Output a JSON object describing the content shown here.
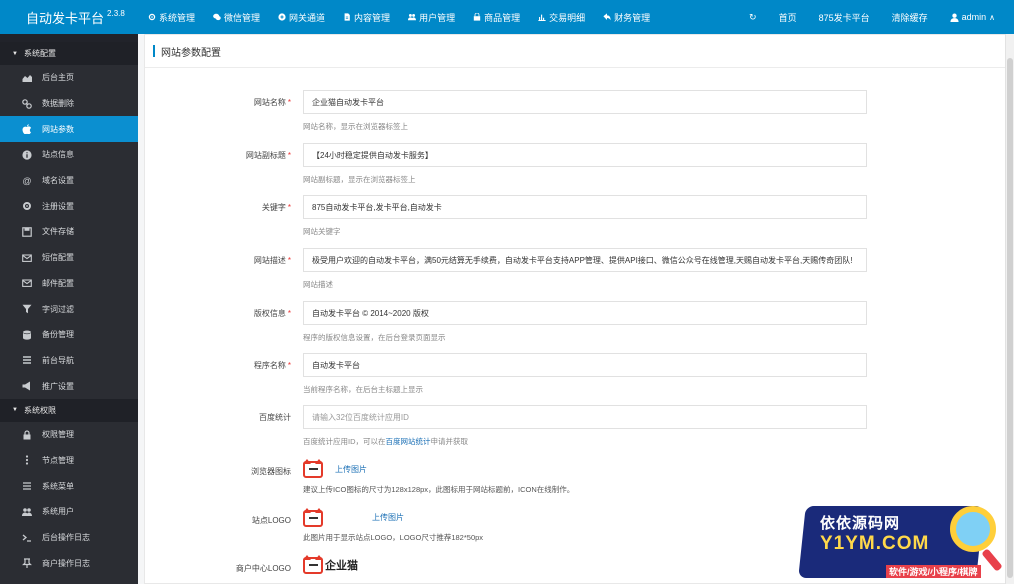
{
  "app": {
    "title": "自动发卡平台",
    "version": "2.3.8"
  },
  "topnav": [
    {
      "label": "系统管理",
      "icon": "gear-icon"
    },
    {
      "label": "微信管理",
      "icon": "wechat-icon"
    },
    {
      "label": "网关通道",
      "icon": "gateway-icon"
    },
    {
      "label": "内容管理",
      "icon": "document-icon"
    },
    {
      "label": "用户管理",
      "icon": "users-icon"
    },
    {
      "label": "商品管理",
      "icon": "shop-icon"
    },
    {
      "label": "交易明细",
      "icon": "chart-icon"
    },
    {
      "label": "财务管理",
      "icon": "finance-icon"
    }
  ],
  "topright": {
    "refresh_icon": "refresh-icon",
    "home": "首页",
    "site": "875发卡平台",
    "clear_cache": "清除缓存",
    "user": "admin"
  },
  "sidebar": {
    "groups": [
      {
        "title": "系统配置",
        "items": [
          {
            "label": "后台主页",
            "icon": "area-chart-icon"
          },
          {
            "label": "数据删除",
            "icon": "link-icon"
          },
          {
            "label": "网站参数",
            "icon": "apple-icon",
            "active": true
          },
          {
            "label": "站点信息",
            "icon": "info-icon"
          },
          {
            "label": "域名设置",
            "icon": "at-icon"
          },
          {
            "label": "注册设置",
            "icon": "cog-icon"
          },
          {
            "label": "文件存储",
            "icon": "save-icon"
          },
          {
            "label": "短信配置",
            "icon": "envelope-icon"
          },
          {
            "label": "邮件配置",
            "icon": "mail-icon"
          },
          {
            "label": "字词过滤",
            "icon": "filter-icon"
          },
          {
            "label": "备份管理",
            "icon": "database-icon"
          },
          {
            "label": "前台导航",
            "icon": "menu-icon"
          },
          {
            "label": "推广设置",
            "icon": "bullhorn-icon"
          }
        ]
      },
      {
        "title": "系统权限",
        "items": [
          {
            "label": "权限管理",
            "icon": "lock-icon"
          },
          {
            "label": "节点管理",
            "icon": "vertical-dots-icon"
          },
          {
            "label": "系统菜单",
            "icon": "list-icon"
          },
          {
            "label": "系统用户",
            "icon": "users-icon"
          },
          {
            "label": "后台操作日志",
            "icon": "terminal-icon"
          },
          {
            "label": "商户操作日志",
            "icon": "pin-icon"
          }
        ]
      }
    ]
  },
  "panel": {
    "title": "网站参数配置"
  },
  "form": {
    "site_name": {
      "label": "网站名称",
      "value": "企业猫自动发卡平台",
      "hint": "网站名称，显示在浏览器标签上"
    },
    "subtitle": {
      "label": "网站副标题",
      "value": "【24小时稳定提供自动发卡服务】",
      "hint": "网站副标题，显示在浏览器标签上"
    },
    "keywords": {
      "label": "关键字",
      "value": "875自动发卡平台,发卡平台,自动发卡",
      "hint": "网站关键字"
    },
    "description": {
      "label": "网站描述",
      "value": "极受用户欢迎的自动发卡平台，满50元结算无手续费，自动发卡平台支持APP管理、提供API接口、微信公众号在线管理,天赐自动发卡平台,天赐传奇团队!",
      "hint": "网站描述"
    },
    "copyright": {
      "label": "版权信息",
      "value": "自动发卡平台 © 2014~2020 版权",
      "hint": "程序的版权信息设置，在后台登录页面显示"
    },
    "program_name": {
      "label": "程序名称",
      "value": "自动发卡平台",
      "hint": "当前程序名称，在后台主标题上显示"
    },
    "baidu": {
      "label": "百度统计",
      "placeholder": "请输入32位百度统计应用ID",
      "hint_pre": "百度统计应用ID，可以在",
      "hint_link": "百度网站统计",
      "hint_post": "申请并获取"
    },
    "favicon": {
      "label": "浏览器图标",
      "upload": "上传图片",
      "hint": "建议上传ICO图标的尺寸为128x128px，此图标用于网站标题前，ICON在线制作。"
    },
    "site_logo": {
      "label": "站点LOGO",
      "upload": "上传图片",
      "hint": "此图片用于显示站点LOGO，LOGO尺寸推荐182*50px"
    },
    "merchant_logo": {
      "label": "商户中心LOGO",
      "logo_text": "企业猫"
    }
  },
  "watermark": {
    "line1": "依依源码网",
    "line2": "Y1YM.COM",
    "line3": "软件/游戏/小程序/棋牌"
  },
  "colors": {
    "topbar": "#0088c8",
    "sidebar": "#2b2d33",
    "active": "#0b8fd0",
    "required": "#e33333"
  }
}
